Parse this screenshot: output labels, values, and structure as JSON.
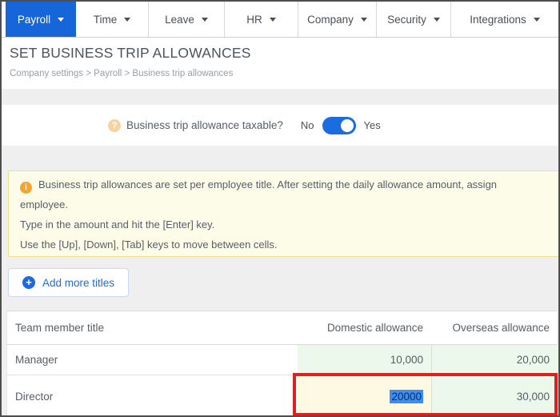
{
  "nav": {
    "items": [
      {
        "label": "Payroll",
        "active": true
      },
      {
        "label": "Time",
        "active": false
      },
      {
        "label": "Leave",
        "active": false
      },
      {
        "label": "HR",
        "active": false
      },
      {
        "label": "Company",
        "active": false
      },
      {
        "label": "Security",
        "active": false
      },
      {
        "label": "Integrations",
        "active": false
      }
    ]
  },
  "header": {
    "title": "SET BUSINESS TRIP ALLOWANCES",
    "breadcrumb": "Company settings > Payroll > Business trip allowances"
  },
  "taxable_toggle": {
    "help_icon": "question-circle",
    "question": "?",
    "label": "Business trip allowance taxable?",
    "off_label": "No",
    "on_label": "Yes",
    "state": "Yes"
  },
  "info_box": {
    "icon": "info-circle",
    "icon_glyph": "i",
    "lines": [
      "Business trip allowances are set per employee title. After setting the daily allowance amount, assign",
      "employee.",
      "Type in the amount and hit the [Enter] key.",
      "Use the [Up], [Down], [Tab] keys to move between cells."
    ]
  },
  "add_titles_button": {
    "icon": "plus-circle",
    "plus_glyph": "+",
    "label": "Add more titles"
  },
  "table": {
    "columns": [
      "Team member title",
      "Domestic allowance",
      "Overseas allowance"
    ],
    "rows": [
      {
        "title": "Manager",
        "domestic": "10,000",
        "overseas": "20,000"
      },
      {
        "title": "Director",
        "domestic": "20000",
        "overseas": "30,000",
        "domestic_state": "editing, text selected"
      }
    ]
  },
  "annotation": {
    "type": "red-highlight-box",
    "target": "Director allowance cells"
  },
  "colors": {
    "nav_active": "#1766d9",
    "toggle_on": "#1b6ce0",
    "info_bg": "#fdfce9",
    "info_border": "#ece28c",
    "info_icon": "#f5a42c",
    "button_accent": "#1d6ae0",
    "cell_green": "#edf8ed",
    "cell_yellow": "#fdf9e3",
    "selection": "#3d8df5",
    "annotation_red": "#e11f1d"
  }
}
